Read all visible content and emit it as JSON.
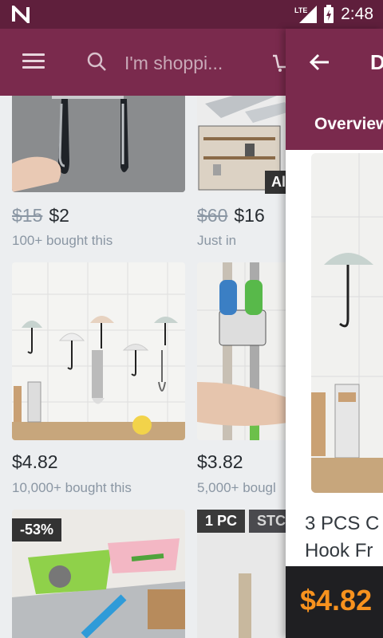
{
  "status": {
    "time": "2:48",
    "network": "LTE"
  },
  "search": {
    "placeholder": "I'm shoppi..."
  },
  "feed": {
    "items": [
      {
        "old_price": "$15",
        "price": "$2",
        "sub": "100+ bought this"
      },
      {
        "old_price": "$60",
        "price": "$16",
        "sub": "Just in",
        "badge": "Al"
      },
      {
        "price": "$4.82",
        "sub": "10,000+ bought this"
      },
      {
        "price": "$3.82",
        "sub": "5,000+ bougl"
      },
      {
        "badge": "-53%"
      },
      {
        "badge": "1 PC",
        "badge2": "STC"
      }
    ]
  },
  "panel": {
    "title": "D",
    "tab": "Overview",
    "product_name_line1": "3 PCS C",
    "product_name_line2": "Hook Fr",
    "price": "$4.82"
  },
  "colors": {
    "appbar": "#7a2a4d",
    "statusbar": "#5f1f3c",
    "price_accent": "#f7921e"
  }
}
